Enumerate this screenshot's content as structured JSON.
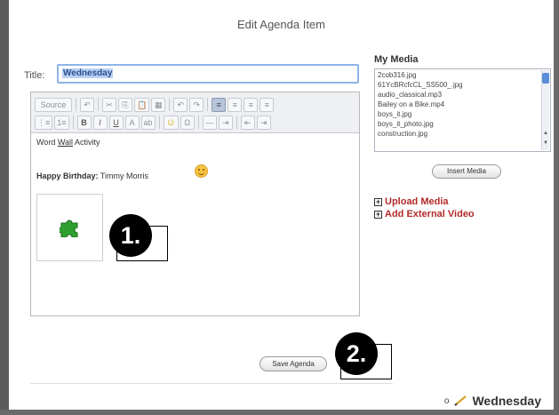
{
  "dialog": {
    "title": "Edit Agenda Item"
  },
  "form": {
    "title_label": "Title:",
    "title_value": "Wednesday"
  },
  "toolbar": {
    "row1": [
      "Source",
      "↶",
      "✂",
      "⎘",
      "📋",
      "▦",
      "↶",
      "↷",
      "≡",
      "≡",
      "≡",
      "≡"
    ],
    "source_label": "Source",
    "row2": [
      "⋮≡",
      "1≡",
      "B",
      "I",
      "U",
      "A",
      "ab",
      "☺",
      "Ω",
      "—",
      "⇥",
      "⇤",
      "⇥"
    ]
  },
  "editor_content": {
    "line1_pre": "Word ",
    "line1_wall": "Wall",
    "line1_post": " Activity",
    "birthday_label": "Happy Birthday:",
    "birthday_name": "Timmy Morris"
  },
  "annotations": {
    "badge1": "1.",
    "badge2": "2."
  },
  "save_button": "Save Agenda",
  "media": {
    "title": "My Media",
    "items": [
      "2cob316.jpg",
      "61YcBRcfcCL_SS500_.jpg",
      "audio_classical.mp3",
      "Bailey on a Bike.mp4",
      "boys_it.jpg",
      "boys_it_photo.jpg",
      "construction.jpg"
    ],
    "insert_button": "Insert Media",
    "upload_link": "Upload Media",
    "external_link": "Add External Video"
  },
  "footer": {
    "day": "Wednesday",
    "dot": "o"
  },
  "colors": {
    "accent_link": "#b22a2a",
    "title_border": "#8fb5e6",
    "scroll_thumb": "#5b8ed8"
  }
}
